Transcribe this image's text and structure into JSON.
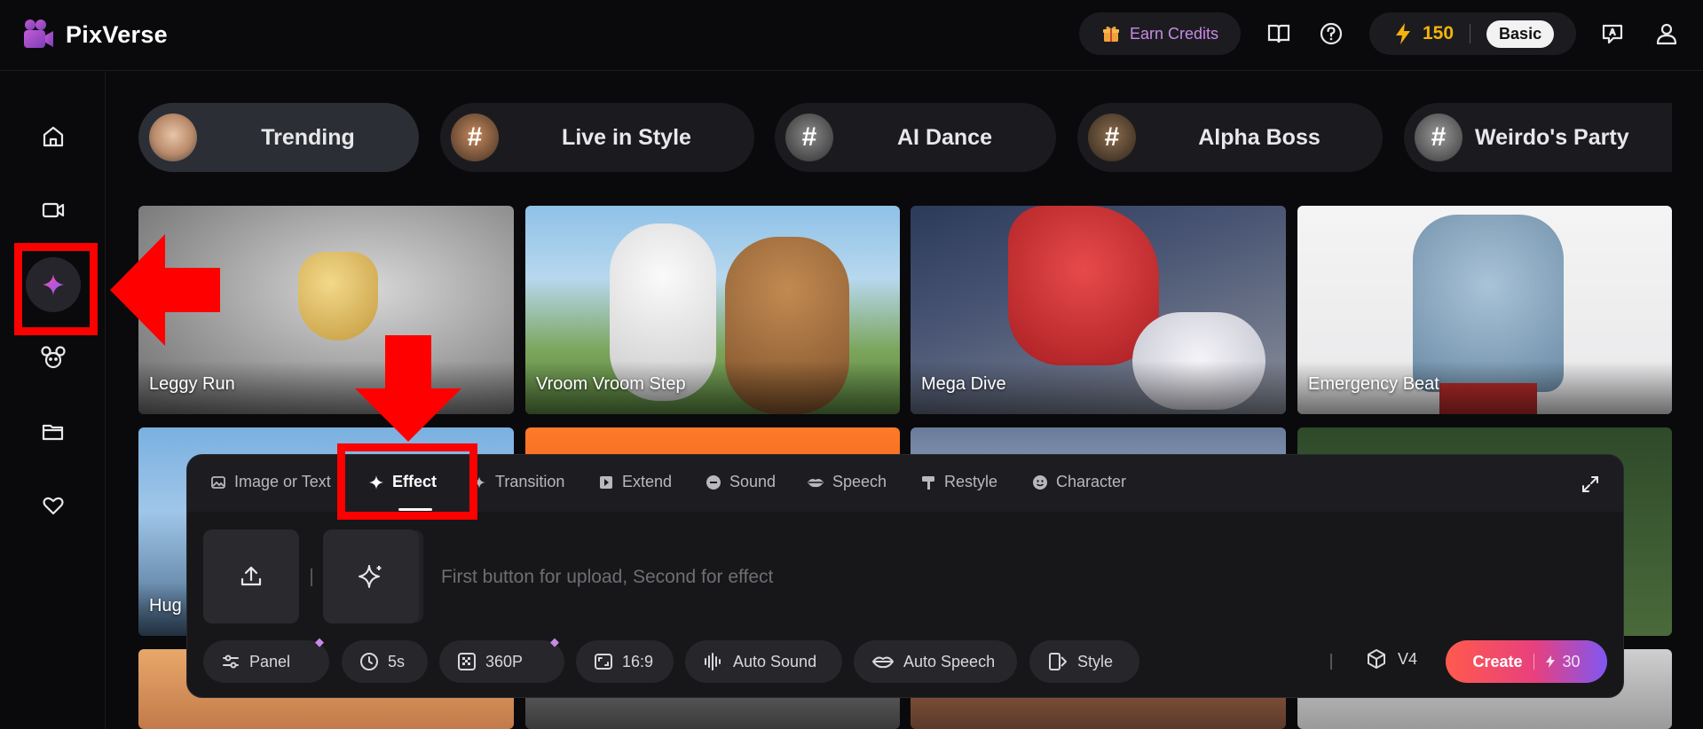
{
  "app": {
    "name": "PixVerse"
  },
  "header": {
    "earn_credits": "Earn Credits",
    "credits": "150",
    "plan": "Basic"
  },
  "sidebar": {
    "items": [
      "home",
      "video",
      "effects",
      "character",
      "assets",
      "favorites"
    ],
    "active": "effects"
  },
  "categories": [
    {
      "label": "Trending",
      "active": true
    },
    {
      "label": "Live in Style",
      "active": false
    },
    {
      "label": "AI Dance",
      "active": false
    },
    {
      "label": "Alpha Boss",
      "active": false
    },
    {
      "label": "Weirdo's Party",
      "active": false
    }
  ],
  "videos": [
    {
      "label": "Leggy Run"
    },
    {
      "label": "Vroom Vroom Step"
    },
    {
      "label": "Mega Dive"
    },
    {
      "label": "Emergency Beat"
    },
    {
      "label": "Hug"
    }
  ],
  "panel": {
    "tabs": [
      "Image or Text",
      "Effect",
      "Transition",
      "Extend",
      "Sound",
      "Speech",
      "Restyle",
      "Character"
    ],
    "active_tab": "Effect",
    "prompt_placeholder": "First button for upload, Second for effect",
    "options": {
      "panel": "Panel",
      "duration": "5s",
      "resolution": "360P",
      "aspect": "16:9",
      "auto_sound": "Auto Sound",
      "auto_speech": "Auto Speech",
      "style": "Style"
    },
    "model": "V4",
    "create_label": "Create",
    "create_cost": "30"
  },
  "colors": {
    "accent_gold": "#f5b30c",
    "accent_purple": "#c88ae6",
    "annotation_red": "#ff0000"
  }
}
